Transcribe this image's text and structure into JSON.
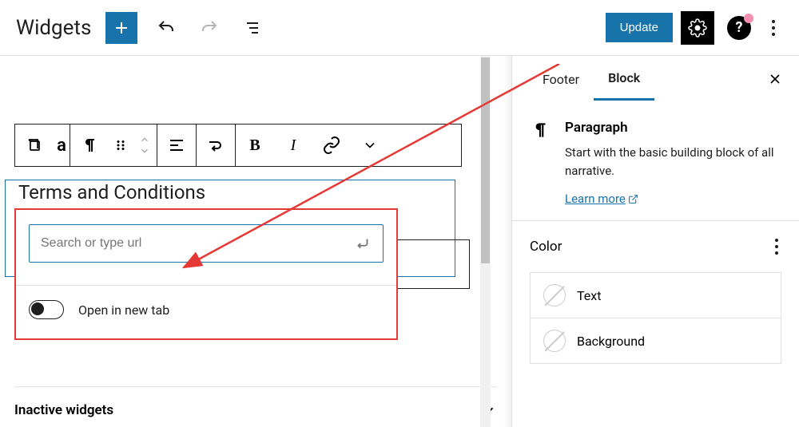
{
  "header": {
    "title": "Widgets",
    "update_label": "Update"
  },
  "block_toolbar": {
    "groups": [
      "block-type",
      "paragraph",
      "move",
      "align",
      "transform",
      "bold",
      "italic",
      "link",
      "more"
    ]
  },
  "editor": {
    "paragraph_text": "Terms and Conditions",
    "link_panel": {
      "url_placeholder": "Search or type url",
      "open_new_tab_label": "Open in new tab",
      "open_new_tab_value": false
    },
    "inactive_widgets_label": "Inactive widgets"
  },
  "sidebar": {
    "tabs": [
      {
        "id": "footer",
        "label": "Footer",
        "active": false
      },
      {
        "id": "block",
        "label": "Block",
        "active": true
      }
    ],
    "block_card": {
      "name": "Paragraph",
      "description": "Start with the basic building block of all narrative.",
      "learn_more_label": "Learn more"
    },
    "color_section": {
      "title": "Color",
      "items": [
        {
          "label": "Text"
        },
        {
          "label": "Background"
        }
      ]
    }
  },
  "colors": {
    "primary": "#1873aa",
    "annotation": "#e53935"
  }
}
